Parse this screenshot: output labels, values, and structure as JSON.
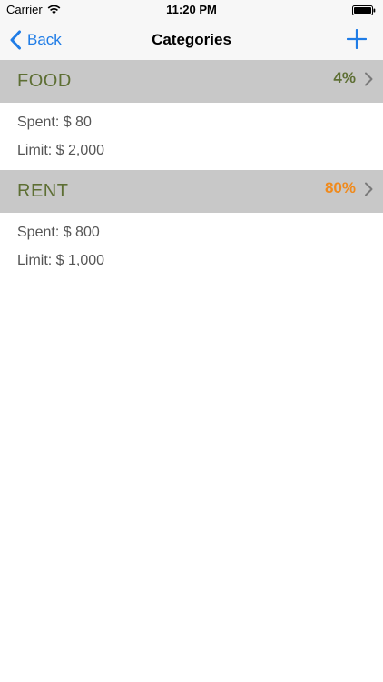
{
  "status_bar": {
    "carrier": "Carrier",
    "time": "11:20 PM",
    "wifi_icon": "wifi-icon",
    "battery_icon": "battery-icon"
  },
  "nav": {
    "back_label": "Back",
    "title": "Categories",
    "back_icon": "chevron-left-icon",
    "add_icon": "plus-icon",
    "accent_color": "#1f7ce6"
  },
  "categories": [
    {
      "name": "FOOD",
      "percent": "4%",
      "percent_color": "#5e6f34",
      "spent": "Spent: $ 80",
      "limit": "Limit: $ 2,000"
    },
    {
      "name": "RENT",
      "percent": "80%",
      "percent_color": "#f08a1c",
      "spent": "Spent: $ 800",
      "limit": "Limit: $ 1,000"
    }
  ],
  "colors": {
    "header_bg": "#c8c8c8",
    "category_name": "#5e6f34",
    "detail_text": "#555555"
  }
}
